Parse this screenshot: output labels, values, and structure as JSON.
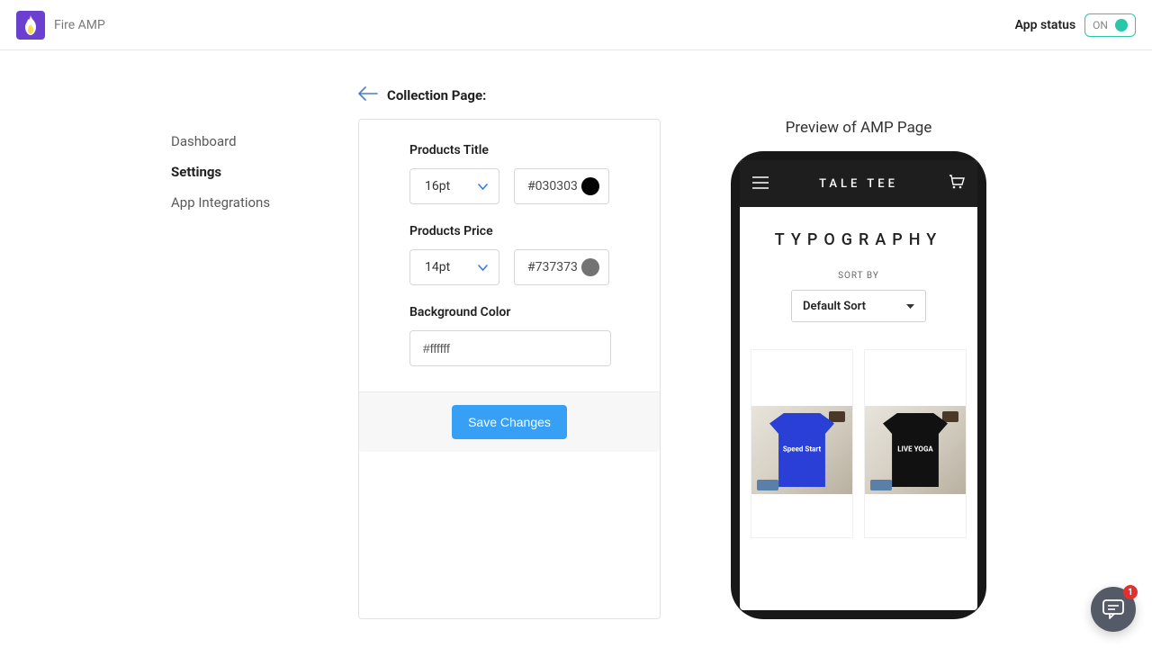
{
  "header": {
    "app_name": "Fire AMP",
    "status_label": "App status",
    "status_text": "ON"
  },
  "sidebar": {
    "items": [
      {
        "label": "Dashboard"
      },
      {
        "label": "Settings"
      },
      {
        "label": "App Integrations"
      }
    ],
    "active_index": 1
  },
  "breadcrumb": {
    "title": "Collection Page:"
  },
  "settings": {
    "products_title": {
      "label": "Products Title",
      "size": "16pt",
      "color": "#030303"
    },
    "products_price": {
      "label": "Products Price",
      "size": "14pt",
      "color": "#737373"
    },
    "background": {
      "label": "Background Color",
      "value": "#ffffff"
    },
    "save_label": "Save Changes"
  },
  "preview": {
    "title": "Preview of AMP Page",
    "store_name": "TALE TEE",
    "collection_heading": "TYPOGRAPHY",
    "sort_label": "SORT BY",
    "sort_value": "Default Sort",
    "products": [
      {
        "graphic": "Speed Start"
      },
      {
        "graphic": "LIVE YOGA"
      }
    ]
  },
  "chat": {
    "badge_count": "1"
  }
}
